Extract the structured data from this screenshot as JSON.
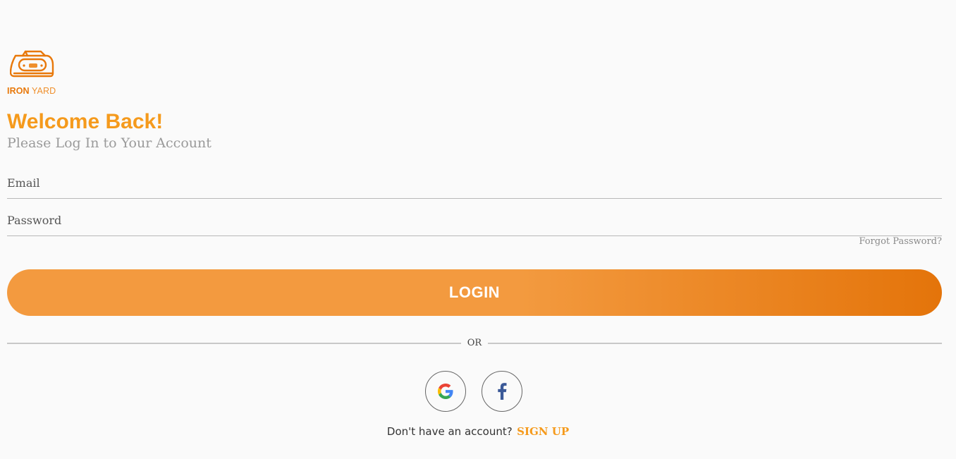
{
  "brand": {
    "name_bold": "IRON",
    "name_light": "YARD",
    "logo_icon": "iron-icon",
    "accent_color": "#f59a1c"
  },
  "header": {
    "title": "Welcome Back!",
    "subtitle": "Please Log In to Your Account"
  },
  "form": {
    "email_placeholder": "Email",
    "email_value": "",
    "password_placeholder": "Password",
    "password_value": "",
    "forgot_label": "Forgot Password?",
    "login_label": "LOGIN"
  },
  "divider": {
    "label": "OR"
  },
  "social": {
    "google_icon": "google-icon",
    "facebook_icon": "facebook-icon"
  },
  "footer": {
    "prompt": "Don't have an account?",
    "signup_label": "SIGN UP"
  },
  "colors": {
    "background": "#fafafa",
    "button_start": "#f39a3f",
    "button_end": "#e4740a",
    "muted_text": "#9a9a9a"
  }
}
